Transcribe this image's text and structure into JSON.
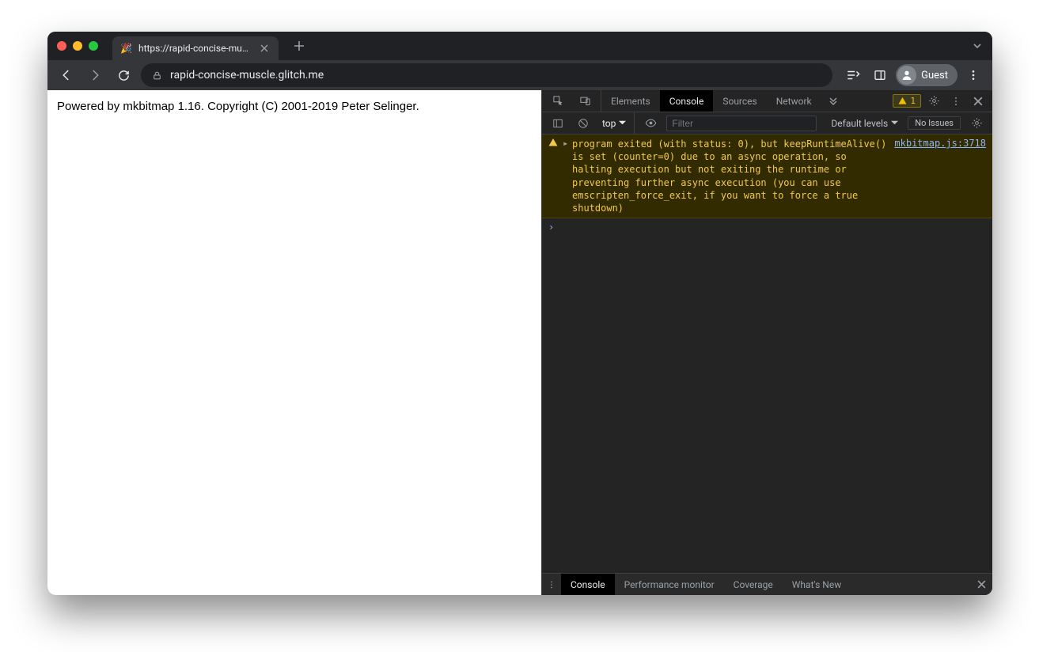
{
  "tab": {
    "title": "https://rapid-concise-muscle.g",
    "favicon": "🎉"
  },
  "url": "rapid-concise-muscle.glitch.me",
  "guest_label": "Guest",
  "page_text": "Powered by mkbitmap 1.16. Copyright (C) 2001-2019 Peter Selinger.",
  "devtools": {
    "tabs": [
      "Elements",
      "Console",
      "Sources",
      "Network"
    ],
    "active_tab": "Console",
    "warn_count": "1",
    "console_bar": {
      "context": "top",
      "filter_placeholder": "Filter",
      "levels_label": "Default levels",
      "issues_label": "No Issues"
    },
    "log": {
      "message": "program exited (with status: 0), but keepRuntimeAlive() is set (counter=0) due to an async operation, so halting execution but not exiting the runtime or preventing further async execution (you can use emscripten_force_exit, if you want to force a true shutdown)",
      "source": "mkbitmap.js:3718"
    },
    "drawer_tabs": [
      "Console",
      "Performance monitor",
      "Coverage",
      "What's New"
    ],
    "drawer_active": "Console"
  }
}
